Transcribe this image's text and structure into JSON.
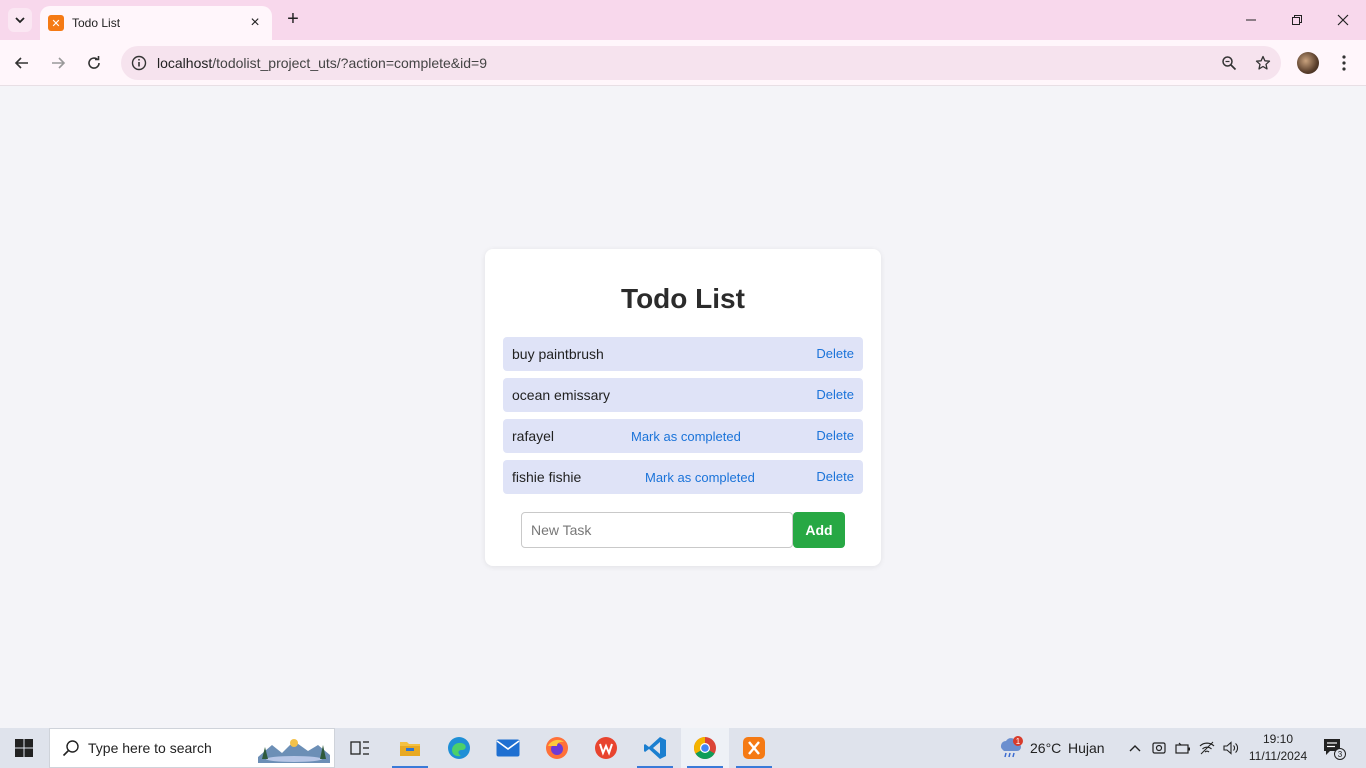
{
  "browser": {
    "tab_title": "Todo List",
    "url_host": "localhost",
    "url_path": "/todolist_project_uts/?action=complete&id=9"
  },
  "page": {
    "title": "Todo List",
    "tasks": [
      {
        "name": "buy paintbrush",
        "complete_label": "",
        "delete_label": "Delete"
      },
      {
        "name": "ocean emissary",
        "complete_label": "",
        "delete_label": "Delete"
      },
      {
        "name": "rafayel",
        "complete_label": "Mark as completed",
        "delete_label": "Delete"
      },
      {
        "name": "fishie fishie",
        "complete_label": "Mark as completed",
        "delete_label": "Delete"
      }
    ],
    "new_task_placeholder": "New Task",
    "add_label": "Add"
  },
  "taskbar": {
    "search_placeholder": "Type here to search",
    "weather_temp": "26°C",
    "weather_desc": "Hujan",
    "weather_badge": "1",
    "time": "19:10",
    "date": "11/11/2024",
    "notification_count": "3"
  },
  "colors": {
    "accent_link": "#1a73d9",
    "add_button": "#27a844",
    "task_bg": "#dfe3f7",
    "tab_strip": "#f8d8ec"
  }
}
